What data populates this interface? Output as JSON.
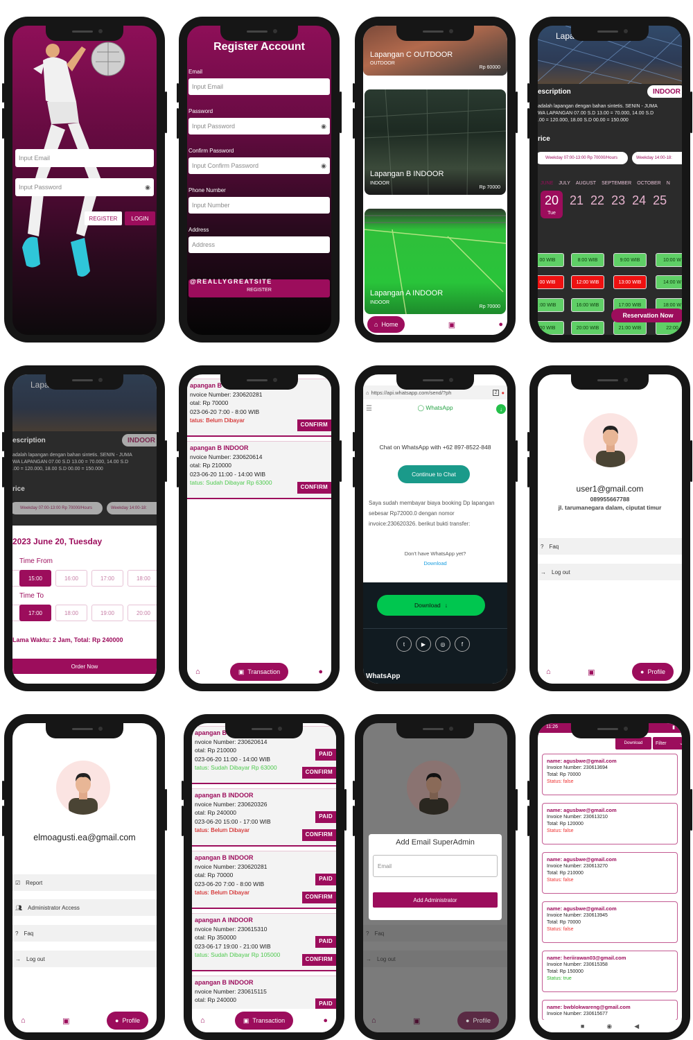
{
  "colors": {
    "accent": "#9c0d5c",
    "green": "#5fcf66",
    "red": "#e11111",
    "whatsapp": "#00c64f"
  },
  "login": {
    "email_placeholder": "Input Email",
    "password_placeholder": "Input Password",
    "register": "REGISTER",
    "login": "LOGIN"
  },
  "register": {
    "title": "Register Account",
    "fields": [
      {
        "label": "Email",
        "placeholder": "Input Email"
      },
      {
        "label": "Password",
        "placeholder": "Input Password"
      },
      {
        "label": "Confirm Password",
        "placeholder": "Input Confirm Password"
      },
      {
        "label": "Phone Number",
        "placeholder": "Input Number"
      },
      {
        "label": "Address",
        "placeholder": "Address"
      }
    ],
    "watermark": "@REALLYGREATSITE",
    "button": "REGISTER"
  },
  "home": {
    "fields": [
      {
        "name": "Lapangan C OUTDOOR",
        "type": "OUTDOOR",
        "price": "Rp 60000"
      },
      {
        "name": "Lapangan B INDOOR",
        "type": "INDOOR",
        "price": "Rp 70000"
      },
      {
        "name": "Lapangan A INDOOR",
        "type": "INDOOR",
        "price": "Rp 70000"
      }
    ],
    "nav_home": "Home"
  },
  "detail": {
    "title": "Lapangan B INDOOR",
    "desc_label": "escription",
    "badge": "INDOOR",
    "desc_lines": [
      "adalah lapangan dengan bahan sintetis. SENIN - JUMA",
      "WA LAPANGAN 07.00 S.D 13.00 = 70.000,  14.00 S.D",
      ".00 = 120.000,  18.00 S.D 00.00 = 150.000"
    ],
    "price_label": "rice",
    "price_chips": [
      "Weekday 07:00-13:00 Rp 70000/Hours",
      "Weekday 14:00-18:"
    ],
    "months": [
      "JUNE",
      "JULY",
      "AUGUST",
      "SEPTEMBER",
      "OCTOBER",
      "N"
    ],
    "dates": [
      "20",
      "21",
      "22",
      "23",
      "24",
      "25"
    ],
    "selected_day": "Tue",
    "slots": [
      [
        "00 WIB",
        "8:00 WIB",
        "9:00 WIB",
        "10:00 W"
      ],
      [
        "00 WIB",
        "12:00 WIB",
        "13:00 WIB",
        "14:00 W"
      ],
      [
        ":00 WIB",
        "16:00 WIB",
        "17:00 WIB",
        "18:00 W"
      ],
      [
        "00 WIB",
        "20:00 WIB",
        "21:00 WIB",
        "22:00 "
      ]
    ],
    "reserve": "Reservation Now"
  },
  "order": {
    "title": "Lapangan B INDOOR",
    "date": "2023 June 20, Tuesday",
    "time_from": "Time From",
    "from_times": [
      "15:00",
      "16:00",
      "17:00",
      "18:00"
    ],
    "time_to": "Time To",
    "to_times": [
      "17:00",
      "18:00",
      "19:00",
      "20:00"
    ],
    "summary": "Lama Waktu: 2 Jam, Total: Rp 240000",
    "button": "Order Now"
  },
  "trans1": {
    "items": [
      {
        "title": "apangan B INDOOR",
        "invoice": "nvoice Number: 230620281",
        "total": "otal: Rp 70000",
        "time": "023-06-20  7:00 - 8:00 WIB",
        "status": "tatus: Belum Dibayar",
        "action": "CONFIRM"
      },
      {
        "title": "apangan B INDOOR",
        "invoice": "nvoice Number: 230620614",
        "total": "otal: Rp 210000",
        "time": "023-06-20  11:00 - 14:00 WIB",
        "status": "tatus: Sudah Dibayar Rp 63000",
        "action": "CONFIRM"
      }
    ],
    "nav": "Transaction"
  },
  "wa": {
    "url": "https://api.whatsapp.com/send/?ph",
    "tabs": "2",
    "brand": "WhatsApp",
    "chat_text": "Chat on WhatsApp with +62 897-8522-848",
    "continue": "Continue to Chat",
    "message": "Saya sudah membayar biaya booking Dp lapangan sebesar Rp72000.0 dengan nomor invoice:230620326. berikut bukti transfer:",
    "no_app": "Don't have WhatsApp yet?",
    "download_link": "Download",
    "download_btn": "Download",
    "footer": "WhatsApp"
  },
  "profile1": {
    "title": "Profile",
    "email": "user1@gmail.com",
    "phone": "089955667788",
    "address": "jl. tarumanegara dalam, ciputat timur",
    "menu": [
      "Faq",
      "Log out"
    ],
    "nav": "Profile"
  },
  "profile2": {
    "title": "Profile",
    "email": "elmoagusti.ea@gmail.com",
    "menu": [
      "Report",
      "Administrator Access",
      "Faq",
      "Log out"
    ],
    "nav": "Profile"
  },
  "trans2": {
    "items": [
      {
        "title": "apangan B INDOOR",
        "invoice": "nvoice Number: 230620614",
        "total": "otal: Rp 210000",
        "time": "023-06-20  11:00 - 14:00 WIB",
        "status": "tatus: Sudah Dibayar Rp 63000",
        "paid": "PAID",
        "action": "CONFIRM"
      },
      {
        "title": "apangan B INDOOR",
        "invoice": "nvoice Number: 230620326",
        "total": "otal: Rp 240000",
        "time": "023-06-20  15:00 - 17:00 WIB",
        "status": "tatus: Belum Dibayar",
        "paid": "PAID",
        "action": "CONFIRM"
      },
      {
        "title": "apangan B INDOOR",
        "invoice": "nvoice Number: 230620281",
        "total": "otal: Rp 70000",
        "time": "023-06-20  7:00 - 8:00 WIB",
        "status": "tatus: Belum Dibayar",
        "paid": "PAID",
        "action": "CONFIRM"
      },
      {
        "title": "apangan A INDOOR",
        "invoice": "nvoice Number: 230615310",
        "total": "otal: Rp 350000",
        "time": "023-06-17  19:00 - 21:00 WIB",
        "status": "tatus: Sudah Dibayar Rp 105000",
        "paid": "PAID",
        "action": "CONFIRM"
      },
      {
        "title": "apangan B INDOOR",
        "invoice": "nvoice Number: 230615115",
        "total": "otal: Rp 240000",
        "time": "",
        "status": "",
        "paid": "PAID",
        "action": ""
      }
    ],
    "nav": "Transaction"
  },
  "admin_modal": {
    "title": "Add Email SuperAdmin",
    "placeholder": "Email",
    "button": "Add Administrator",
    "menu": [
      "Faq",
      "Log out"
    ],
    "nav": "Profile",
    "profile_title": "Profile"
  },
  "report": {
    "status_time": "11:26",
    "download": "Download",
    "filter": "Filter",
    "cards": [
      {
        "name": "name: agusbwe@gmail.com",
        "invoice": "Invoice Number: 230613694",
        "total": "Total: Rp 70000",
        "status": "Status: false",
        "ok": false
      },
      {
        "name": "name: agusbwe@gmail.com",
        "invoice": "Invoice Number: 230613210",
        "total": "Total: Rp 120000",
        "status": "Status: false",
        "ok": false
      },
      {
        "name": "name: agusbwe@gmail.com",
        "invoice": "Invoice Number: 230613270",
        "total": "Total: Rp 210000",
        "status": "Status: false",
        "ok": false
      },
      {
        "name": "name: agusbwe@gmail.com",
        "invoice": "Invoice Number: 230613945",
        "total": "Total: Rp 70000",
        "status": "Status: false",
        "ok": false
      },
      {
        "name": "name: heriirawan03@gmail.com",
        "invoice": "Invoice Number: 230615358",
        "total": "Total: Rp 150000",
        "status": "Status: true",
        "ok": true
      },
      {
        "name": "name: bwblokwareng@gmail.com",
        "invoice": "Invoice Number: 230615677",
        "total": "",
        "status": "",
        "ok": false
      }
    ]
  }
}
